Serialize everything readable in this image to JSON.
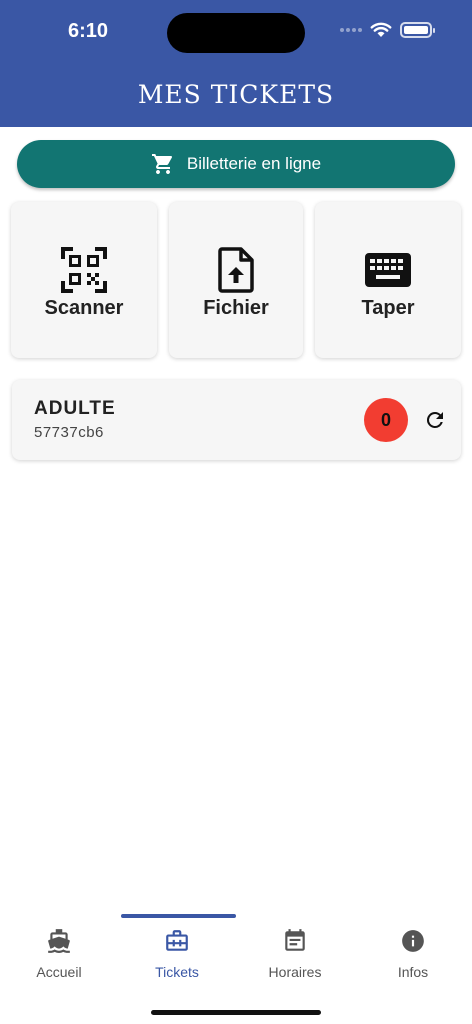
{
  "status_bar": {
    "time": "6:10"
  },
  "header": {
    "title": "MES TICKETS"
  },
  "online_button": {
    "label": "Billetterie en ligne",
    "icon": "cart-icon"
  },
  "actions": [
    {
      "label": "Scanner",
      "icon": "qr-code-icon"
    },
    {
      "label": "Fichier",
      "icon": "file-upload-icon"
    },
    {
      "label": "Taper",
      "icon": "keyboard-icon"
    }
  ],
  "ticket": {
    "type": "ADULTE",
    "code": "57737cb6",
    "count": "0"
  },
  "tabs": [
    {
      "label": "Accueil",
      "icon": "ferry-icon",
      "active": false
    },
    {
      "label": "Tickets",
      "icon": "briefcase-icon",
      "active": true
    },
    {
      "label": "Horaires",
      "icon": "schedule-icon",
      "active": false
    },
    {
      "label": "Infos",
      "icon": "info-icon",
      "active": false
    }
  ],
  "colors": {
    "header": "#3a57a5",
    "online_button": "#127572",
    "count_badge": "#f23d31",
    "active_tab": "#3a57a5"
  }
}
